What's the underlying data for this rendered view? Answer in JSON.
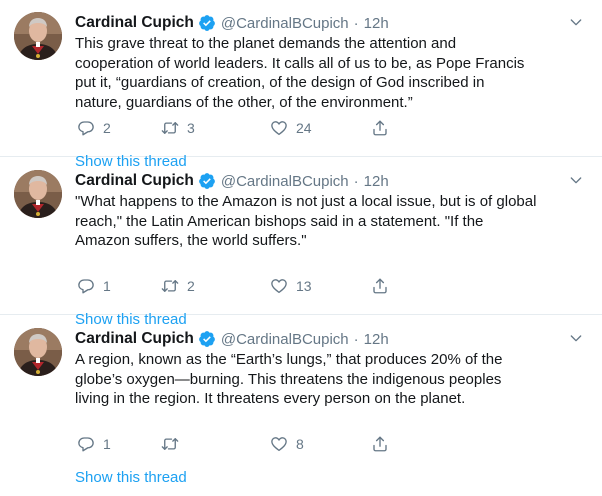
{
  "colors": {
    "text": "#14171a",
    "secondary": "#657786",
    "link": "#1da1f2",
    "verified": "#1da1f2",
    "divider": "#e6ecf0"
  },
  "tweets": [
    {
      "name": "Cardinal Cupich",
      "handle": "@CardinalBCupich",
      "separator": "·",
      "time": "12h",
      "lines": [
        "This grave threat to the planet demands the attention and",
        "cooperation of world leaders. It calls all of us to be, as Pope Francis",
        "put it, “guardians of creation, of the design of God inscribed in",
        "nature, guardians of the other, of the environment.”"
      ],
      "replies": "2",
      "retweets": "3",
      "likes": "24",
      "show_thread": "Show this thread"
    },
    {
      "name": "Cardinal Cupich",
      "handle": "@CardinalBCupich",
      "separator": "·",
      "time": "12h",
      "lines": [
        "\"What happens to the Amazon is not just a local issue, but is of global",
        "reach,\" the Latin American bishops said in a statement. \"If the",
        "Amazon suffers, the world suffers.\""
      ],
      "replies": "1",
      "retweets": "2",
      "likes": "13",
      "show_thread": "Show this thread"
    },
    {
      "name": "Cardinal Cupich",
      "handle": "@CardinalBCupich",
      "separator": "·",
      "time": "12h",
      "lines": [
        "A region, known as the “Earth’s lungs,” that produces 20% of the",
        "globe’s oxygen—burning. This threatens the indigenous peoples",
        "living in the region. It threatens every person on the planet."
      ],
      "replies": "1",
      "retweets": "",
      "likes": "8",
      "show_thread": "Show this thread"
    }
  ],
  "icons": {
    "verified": "verified-badge-icon",
    "caret": "chevron-down-icon",
    "reply": "reply-icon",
    "retweet": "retweet-icon",
    "like": "heart-icon",
    "share": "share-icon"
  }
}
